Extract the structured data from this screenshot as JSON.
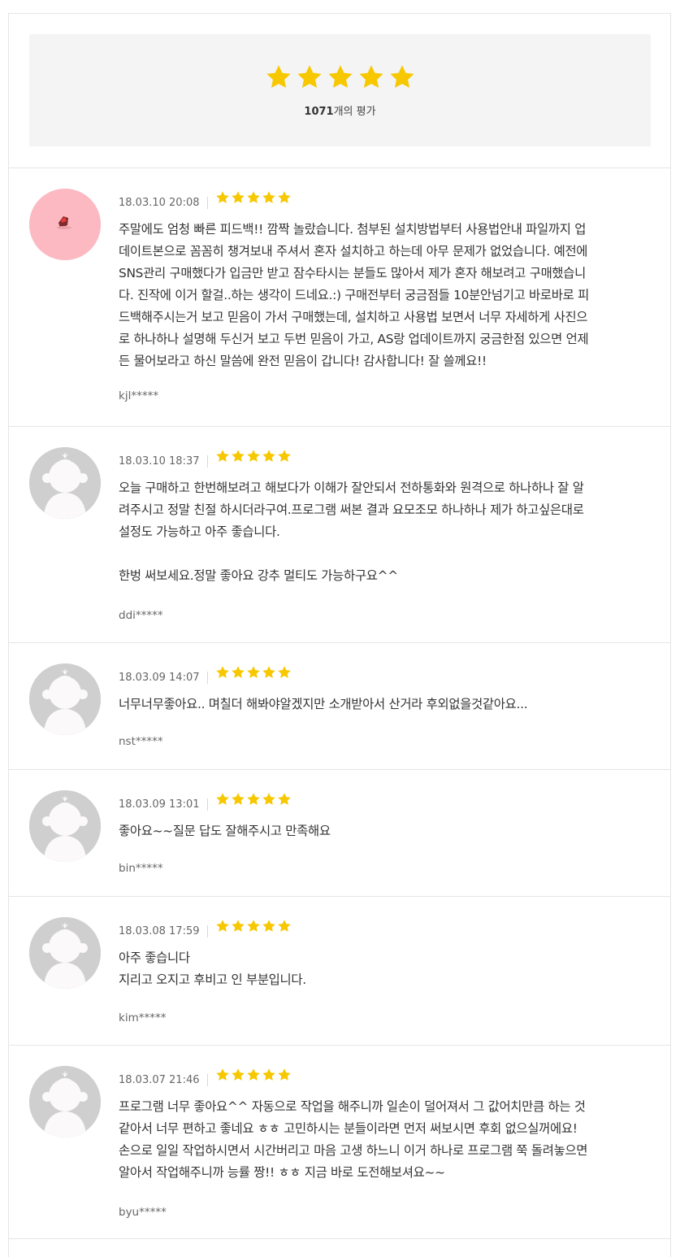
{
  "summary": {
    "count": "1071",
    "count_suffix": "개의 평가",
    "rating": 5,
    "star_color": "#f7c800"
  },
  "reviews": [
    {
      "date": "18.03.10 20:08",
      "rating": 5,
      "avatar": "pink-custom-avatar",
      "text": "주말에도 엄청 빠른 피드백!! 깜짝 놀랐습니다. 첨부된 설치방법부터 사용법안내 파일까지 업\n데이트본으로 꼼꼼히 챙겨보내 주셔서 혼자 설치하고 하는데 아무 문제가 없었습니다. 예전에\nSNS관리 구매했다가 입금만 받고 잠수타시는 분들도 많아서 제가 혼자 해보려고 구매했습니\n다. 진작에 이거 할걸..하는 생각이 드네요.:) 구매전부터 궁금점들 10분안넘기고 바로바로 피\n드백해주시는거 보고 믿음이 가서 구매했는데, 설치하고 사용법 보면서 너무 자세하게 사진으\n로 하나하나 설명해 두신거 보고 두번 믿음이 가고, AS랑 업데이트까지 궁금한점 있으면 언제\n든 물어보라고 하신 말씀에 완전 믿음이 갑니다! 감사합니다! 잘 쓸께요!!",
      "author": "kjl*****"
    },
    {
      "date": "18.03.10 18:37",
      "rating": 5,
      "avatar": "default-avatar",
      "text": "오늘 구매하고 한번해보려고 해보다가 이해가 잘안되서 전하통화와 원격으로 하나하나 잘 알\n려주시고 정말 친절 하시더라구여.프로그램 써본 결과 요모조모 하나하나 제가 하고싶은대로\n설정도 가능하고 아주 좋습니다.\n\n한벙 써보세요.정말 좋아요 강추 멀티도 가능하구요^^",
      "author": "ddi*****"
    },
    {
      "date": "18.03.09 14:07",
      "rating": 5,
      "avatar": "default-avatar",
      "text": "너무너무좋아요.. 며칠더 해봐야알겠지만 소개받아서 산거라 후외없을것같아요...",
      "author": "nst*****"
    },
    {
      "date": "18.03.09 13:01",
      "rating": 5,
      "avatar": "default-avatar",
      "text": "좋아요~~질문 답도 잘해주시고 만족해요",
      "author": "bin*****"
    },
    {
      "date": "18.03.08 17:59",
      "rating": 5,
      "avatar": "default-avatar",
      "text": "아주 좋습니다\n지리고 오지고 후비고 인 부분입니다.",
      "author": "kim*****"
    },
    {
      "date": "18.03.07 21:46",
      "rating": 5,
      "avatar": "default-avatar",
      "text": "프로그램 너무 좋아요^^ 자동으로 작업을 해주니까 일손이 덜어져서 그 값어치만큼 하는 것\n같아서 너무 편하고 좋네요 ㅎㅎ 고민하시는 분들이라면 먼저 써보시면 후회 없으실꺼에요!\n손으로 일일 작업하시면서 시간버리고 마음 고생 하느니 이거 하나로 프로그램 쭉 돌려놓으면\n알아서 작업해주니까 능률 짱!! ㅎㅎ 지금 바로 도전해보셔요~~",
      "author": "byu*****"
    }
  ]
}
